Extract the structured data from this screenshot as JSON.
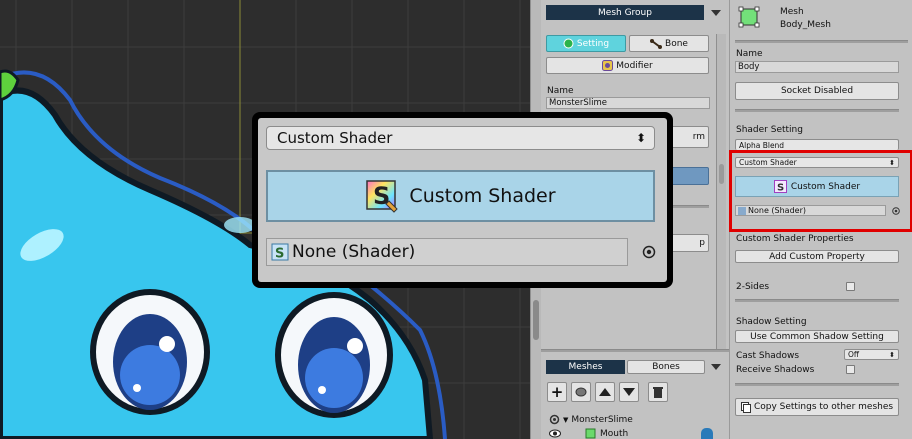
{
  "middle_panel": {
    "mesh_group_label": "Mesh Group",
    "tab_setting": "Setting",
    "tab_bone": "Bone",
    "modifier_label": "Modifier",
    "name_label": "Name",
    "name_value": "MonsterSlime",
    "partial_button_1": "rm",
    "partial_button_2": "p",
    "bottom_tabs": {
      "meshes": "Meshes",
      "bones": "Bones"
    },
    "tree": {
      "root": "MonsterSlime",
      "child": "Mouth"
    }
  },
  "right_panel": {
    "mesh_type": "Mesh",
    "mesh_name": "Body_Mesh",
    "name_label": "Name",
    "name_value": "Body",
    "socket_button": "Socket Disabled",
    "shader_setting_label": "Shader Setting",
    "blend_mode": "Alpha Blend",
    "shader_dropdown": "Custom Shader",
    "custom_shader_button": "Custom Shader",
    "shader_object_field": "None (Shader)",
    "custom_props_label": "Custom Shader Properties",
    "add_prop_button": "Add Custom Property",
    "two_sides_label": "2-Sides",
    "shadow_setting_label": "Shadow Setting",
    "common_shadow_button": "Use Common Shadow Setting",
    "cast_shadows_label": "Cast Shadows",
    "cast_shadows_value": "Off",
    "receive_shadows_label": "Receive Shadows",
    "copy_button": "Copy Settings to other meshes"
  },
  "callout": {
    "shader_dropdown": "Custom Shader",
    "custom_shader_button": "Custom Shader",
    "shader_object_field": "None (Shader)"
  },
  "colors": {
    "selected_tab": "#5fd3dd",
    "custom_shader_button": "#a9d4e8",
    "highlight_box": "#e00000",
    "dark_header": "#1c3348",
    "slime_blue": "#38c6ee",
    "slime_outline": "#1f4fa8"
  },
  "icons": [
    "setting-icon",
    "bone-icon",
    "modifier-icon",
    "mesh-icon",
    "shader-icon",
    "target-icon",
    "add-icon",
    "visibility-icon",
    "folder-icon"
  ]
}
